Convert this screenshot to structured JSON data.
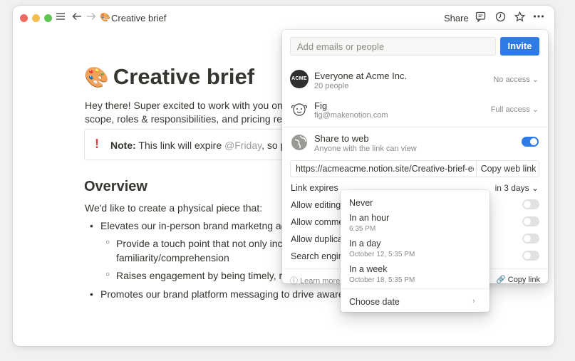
{
  "titlebar": {
    "page_emoji": "🎨",
    "title": "Creative brief",
    "share_label": "Share",
    "icons": [
      "menu-icon",
      "back-arrow-icon",
      "forward-arrow-icon",
      "comment-icon",
      "clock-icon",
      "star-icon",
      "more-icon"
    ]
  },
  "doc": {
    "emoji": "🎨",
    "title": "Creative brief",
    "para1": "Hey there! Super excited to work with you on thi",
    "para2": "scope, roles & responsibilities, and pricing relate",
    "callout_mark": "!",
    "callout_bold": "Note:",
    "callout_text": " This link will expire ",
    "callout_mention": "@Friday",
    "callout_tail": ", so pleas",
    "heading": "Overview",
    "intro": "We'd like to create a physical piece that:",
    "bullets": [
      "Elevates our in-person brand marketng activ",
      "Provide a touch point that not only increa",
      "familiarity/comprehension",
      "Raises engagement by being timely, relev",
      "Promotes our brand platform messaging to drive awareness"
    ]
  },
  "share_panel": {
    "input_placeholder": "Add emails or people",
    "invite_label": "Invite",
    "members": [
      {
        "avatar_text": "ACME",
        "name": "Everyone at Acme Inc.",
        "sub": "20 people",
        "access": "No access"
      },
      {
        "name": "Fig",
        "sub": "fig@makenotion.com",
        "access": "Full access"
      }
    ],
    "web": {
      "title": "Share to web",
      "sub": "Anyone with the link can view",
      "enabled": true
    },
    "url": "https://acmeacme.notion.site/Creative-brief-ed9c",
    "copy_web_label": "Copy web link",
    "link_expires_label": "Link expires",
    "link_expires_value": "in 3 days",
    "options": [
      {
        "label": "Allow editing",
        "enabled": false
      },
      {
        "label": "Allow commen",
        "enabled": false
      },
      {
        "label": "Allow duplicat",
        "enabled": false
      },
      {
        "label": "Search engine",
        "enabled": false
      }
    ],
    "learn_more": "Learn more",
    "footer_mid": "o",
    "copy_link_label": "Copy link"
  },
  "expiry_menu": {
    "items": [
      {
        "label": "Never",
        "sub": ""
      },
      {
        "label": "In an hour",
        "sub": "6:35 PM"
      },
      {
        "label": "In a day",
        "sub": "October 12, 5:35 PM"
      },
      {
        "label": "In a week",
        "sub": "October 18, 5:35 PM"
      }
    ],
    "choose_date": "Choose date"
  },
  "colors": {
    "accent": "#2e7be5",
    "callout_mark": "#e03e3e",
    "traffic_red": "#ed6a5e",
    "traffic_yellow": "#f5bf4f",
    "traffic_green": "#61c554"
  }
}
